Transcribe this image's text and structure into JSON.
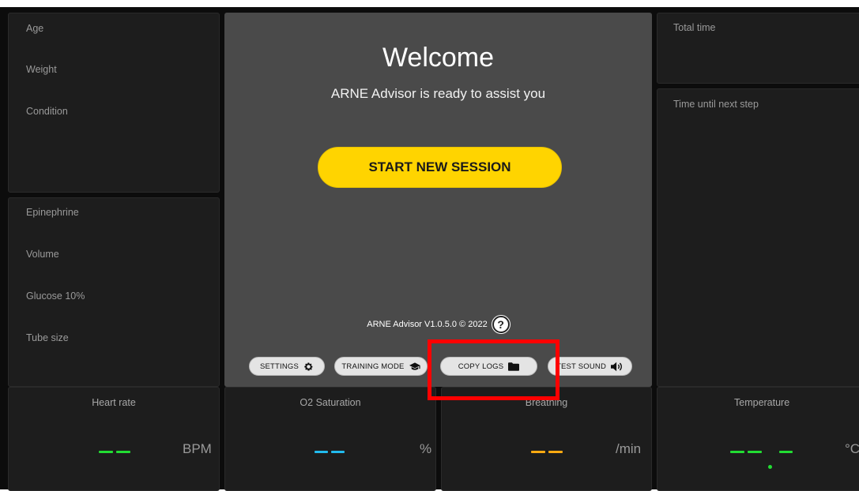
{
  "patient_panel": {
    "age_label": "Age",
    "weight_label": "Weight",
    "condition_label": "Condition"
  },
  "medication_panel": {
    "epinephrine_label": "Epinephrine",
    "volume_label": "Volume",
    "glucose_label": "Glucose 10%",
    "tube_size_label": "Tube size"
  },
  "timers": {
    "total_time_label": "Total time",
    "next_step_label": "Time until next step"
  },
  "welcome": {
    "title": "Welcome",
    "subtitle": "ARNE Advisor is ready to assist you",
    "start_button": "START NEW SESSION",
    "version": "ARNE Advisor V1.0.5.0 © 2022",
    "help_icon": "question-circle-icon"
  },
  "toolbar": {
    "settings": "SETTINGS",
    "training_mode": "TRAINING MODE",
    "copy_logs": "COPY LOGS",
    "test_sound": "TEST SOUND"
  },
  "vitals": {
    "heart_rate": {
      "title": "Heart rate",
      "unit": "BPM",
      "color": "#22dd33"
    },
    "o2": {
      "title": "O2 Saturation",
      "unit": "%",
      "color": "#22bbee"
    },
    "breathing": {
      "title": "Breathing",
      "unit": "/min",
      "color": "#ffaa11"
    },
    "temperature": {
      "title": "Temperature",
      "unit": "°C",
      "color": "#22dd33"
    }
  },
  "colors": {
    "background": "#0c0c0c",
    "panel": "#1d1d1d",
    "center_panel": "#4a4a4a",
    "accent": "#ffd400",
    "highlight": "#ff0000"
  }
}
